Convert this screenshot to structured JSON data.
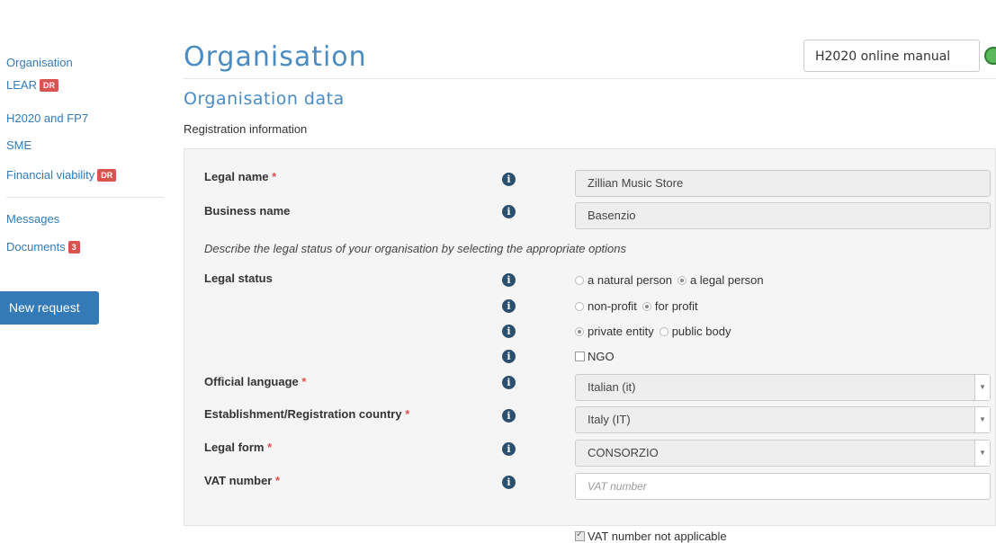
{
  "sidebar": {
    "items": [
      {
        "label": "Organisation"
      },
      {
        "label": "LEAR",
        "badge": "DR"
      },
      {
        "label": "H2020 and FP7"
      },
      {
        "label": "SME"
      },
      {
        "label": "Financial viability",
        "badge": "DR"
      },
      {
        "label": "Messages"
      },
      {
        "label": "Documents",
        "badge": "3"
      }
    ],
    "new_request_label": "New request"
  },
  "header": {
    "title": "Organisation",
    "manual_button": "H2020 online manual",
    "manual_icon": "help-circle-icon"
  },
  "section": {
    "title": "Organisation data",
    "subtitle": "Registration information"
  },
  "form": {
    "legal_name": {
      "label": "Legal name",
      "required": "*",
      "value": "Zillian Music Store"
    },
    "business_name": {
      "label": "Business name",
      "value": "Basenzio"
    },
    "describe_text": "Describe the legal status of your organisation by selecting the appropriate options",
    "legal_status": {
      "label": "Legal status",
      "options": {
        "natural_person": "a natural person",
        "legal_person": "a legal person",
        "non_profit": "non-profit",
        "for_profit": "for profit",
        "private_entity": "private entity",
        "public_body": "public body",
        "ngo": "NGO"
      },
      "selected": [
        "a legal person",
        "for profit",
        "private entity"
      ]
    },
    "official_language": {
      "label": "Official language",
      "required": "*",
      "value": "Italian (it)"
    },
    "country": {
      "label": "Establishment/Registration country",
      "required": "*",
      "value": "Italy (IT)"
    },
    "legal_form": {
      "label": "Legal form",
      "required": "*",
      "value": "CONSORZIO"
    },
    "vat_number": {
      "label": "VAT number",
      "required": "*",
      "placeholder": "VAT number"
    },
    "vat_not_applicable": {
      "label": "VAT number not applicable",
      "checked": true
    }
  },
  "colors": {
    "accent": "#337ab7",
    "badge": "#d9534f",
    "panel": "#f5f5f5"
  }
}
